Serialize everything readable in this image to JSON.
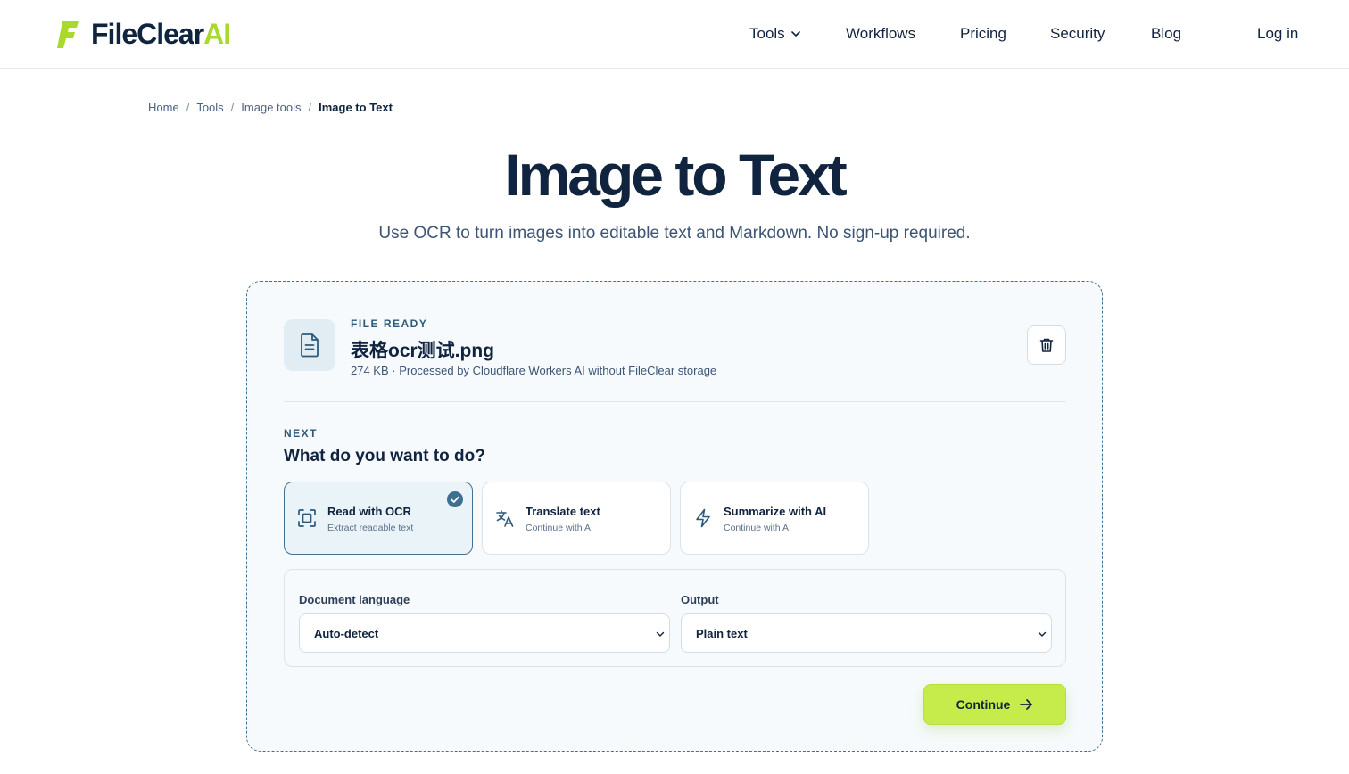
{
  "brand": {
    "name": "FileClear",
    "suffix": "AI",
    "accent": "#a8d92c"
  },
  "nav": {
    "tools": "Tools",
    "workflows": "Workflows",
    "pricing": "Pricing",
    "security": "Security",
    "blog": "Blog",
    "login": "Log in"
  },
  "breadcrumb": {
    "home": "Home",
    "tools": "Tools",
    "image_tools": "Image tools",
    "current": "Image to Text",
    "separator": "/"
  },
  "hero": {
    "title": "Image to Text",
    "subtitle": "Use OCR to turn images into editable text and Markdown. No sign-up required."
  },
  "file": {
    "status_label": "FILE READY",
    "name": "表格ocr测试.png",
    "meta": "274 KB · Processed by Cloudflare Workers AI without FileClear storage",
    "icon": "document-icon"
  },
  "next": {
    "label": "NEXT",
    "question": "What do you want to do?"
  },
  "options": [
    {
      "title": "Read with OCR",
      "subtitle": "Extract readable text",
      "icon": "scan-icon",
      "selected": true
    },
    {
      "title": "Translate text",
      "subtitle": "Continue with AI",
      "icon": "translate-icon",
      "selected": false
    },
    {
      "title": "Summarize with AI",
      "subtitle": "Continue with AI",
      "icon": "lightning-icon",
      "selected": false
    }
  ],
  "settings": {
    "language_label": "Document language",
    "language_value": "Auto-detect",
    "output_label": "Output",
    "output_value": "Plain text"
  },
  "actions": {
    "continue_label": "Continue"
  },
  "colors": {
    "primary_text": "#10233f",
    "accent_green": "#c5ec4b",
    "selected_border": "#44708f",
    "check_fill": "#3d6f90"
  }
}
